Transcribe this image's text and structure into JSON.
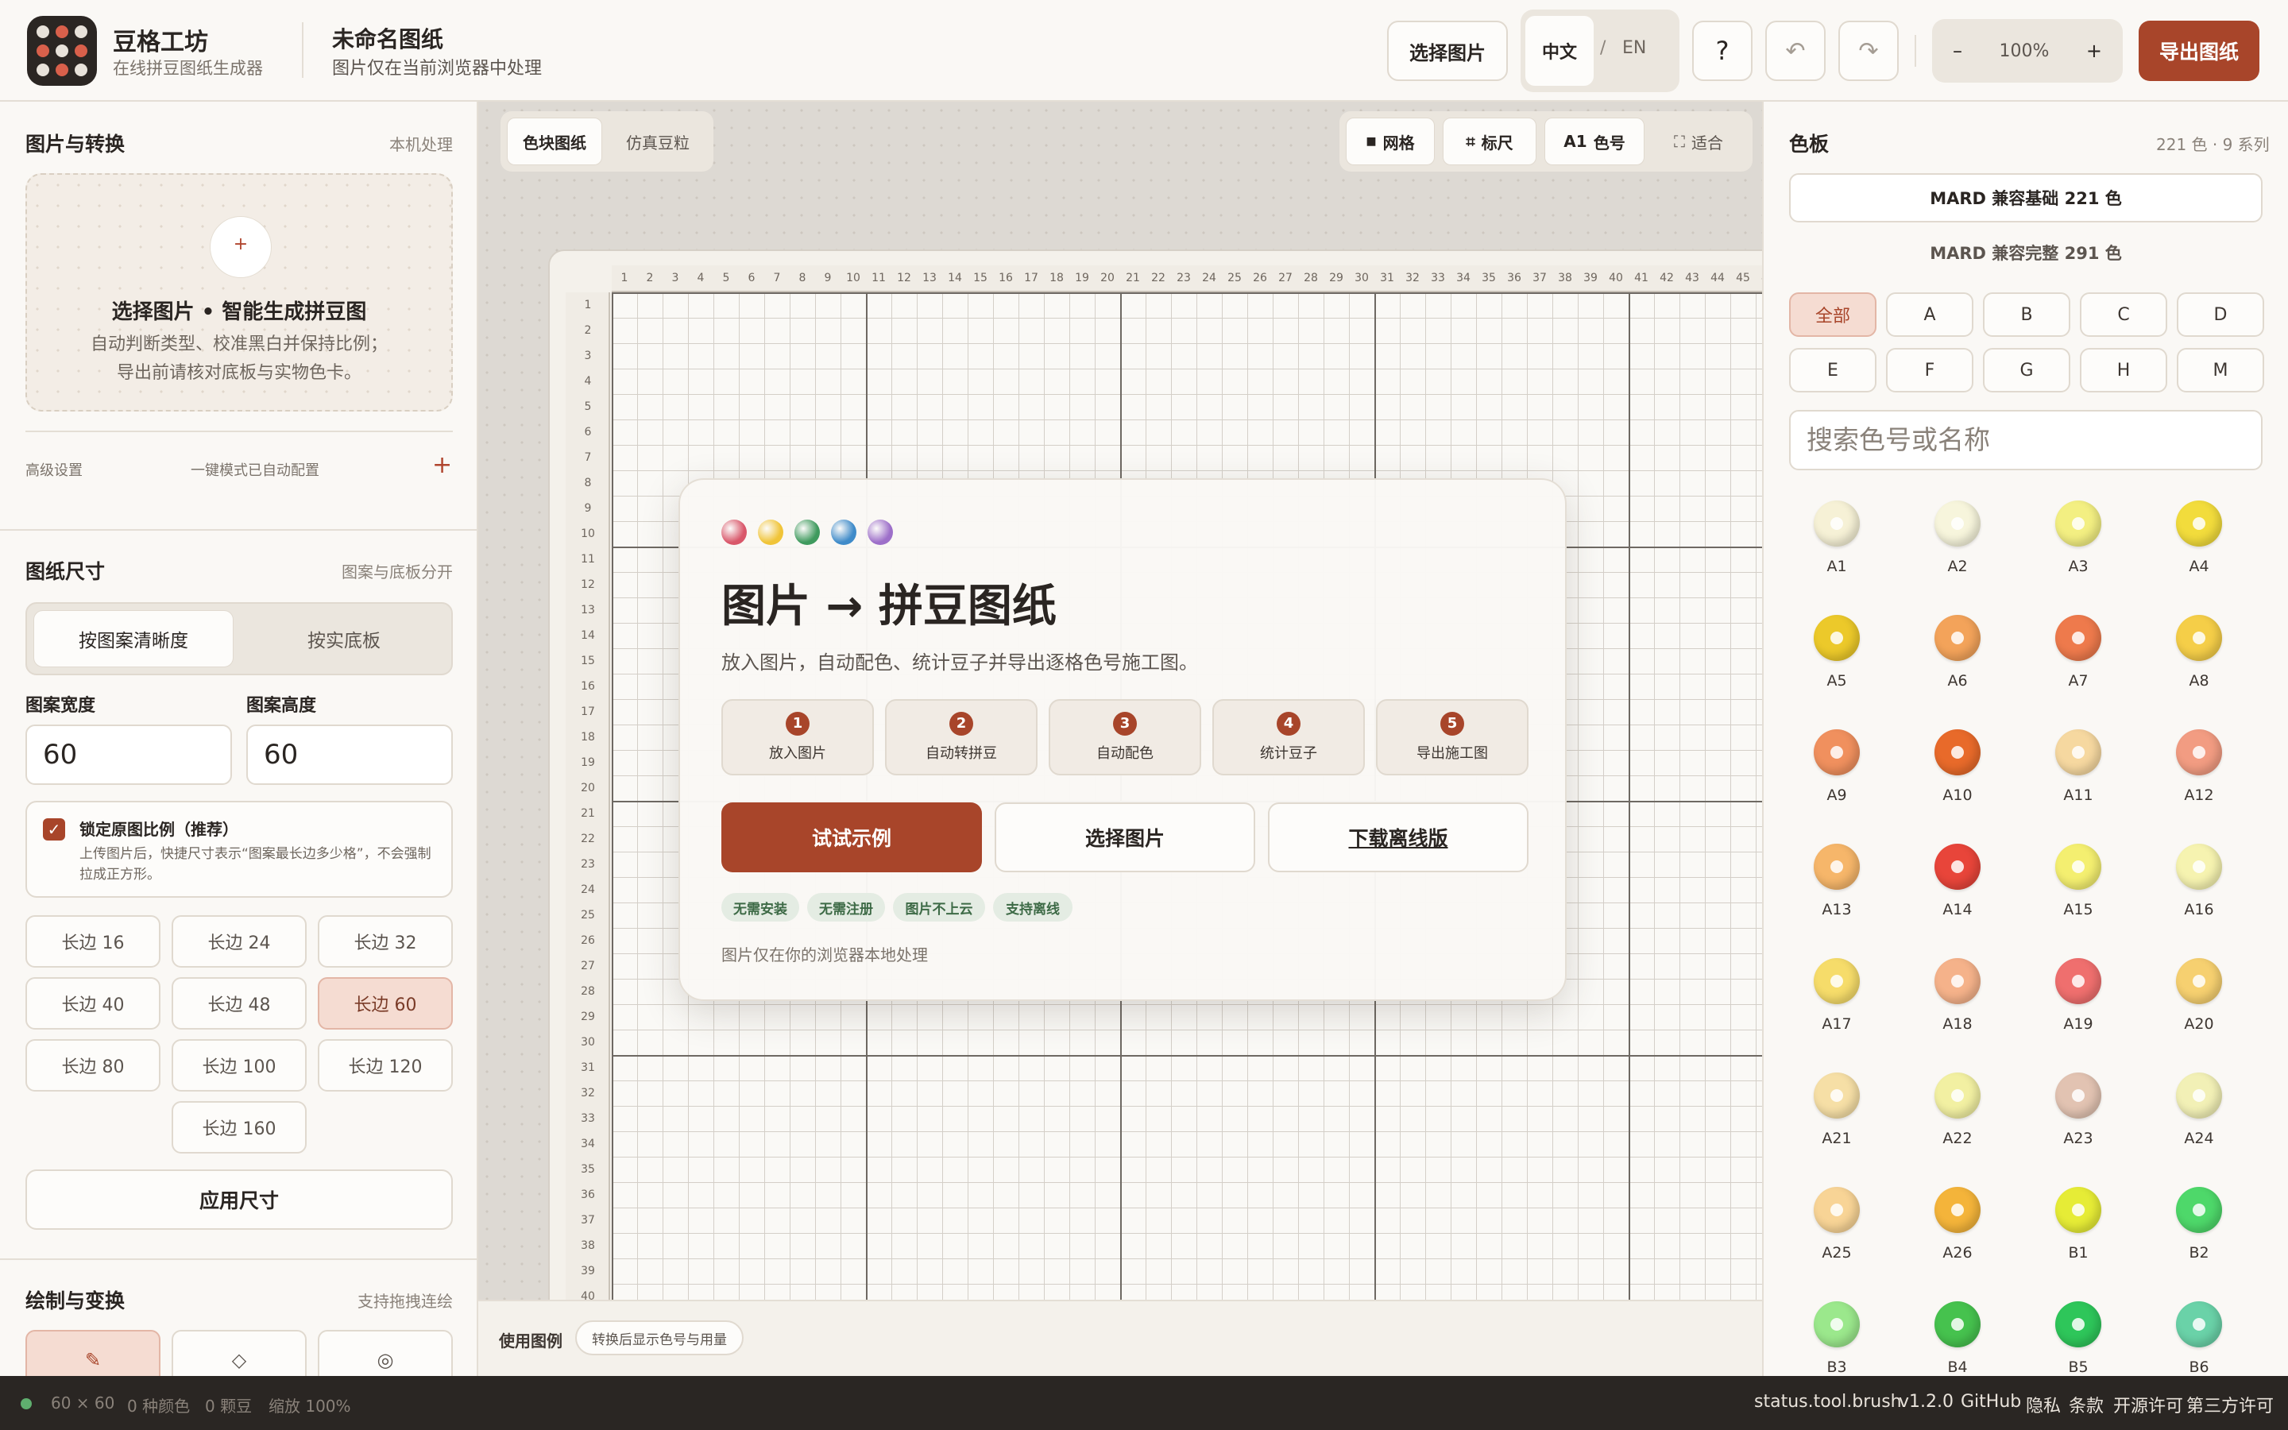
{
  "header": {
    "app_name": "豆格工坊",
    "app_sub": "在线拼豆图纸生成器",
    "doc_title": "未命名图纸",
    "doc_sub": "图片仅在当前浏览器中处理",
    "choose_image": "选择图片",
    "lang_zh": "中文",
    "lang_sep": "/",
    "lang_en": "EN",
    "help": "?",
    "undo": "↶",
    "redo": "↷",
    "zoom_minus": "–",
    "zoom_level": "100%",
    "zoom_plus": "+",
    "export": "导出图纸"
  },
  "left": {
    "image_section": {
      "title": "图片与转换",
      "note": "本机处理",
      "drop_plus": "+",
      "drop_title": "选择图片 • 智能生成拼豆图",
      "drop_desc1": "自动判断类型、校准黑白并保持比例；",
      "drop_desc2": "导出前请核对底板与实物色卡。",
      "advanced": "高级设置",
      "advanced_note": "一键模式已自动配置",
      "advanced_plus": "+"
    },
    "size_section": {
      "title": "图纸尺寸",
      "note": "图案与底板分开",
      "mode_on": "按图案清晰度",
      "mode_off": "按实底板",
      "width_label": "图案宽度",
      "height_label": "图案高度",
      "width_value": "60",
      "height_value": "60",
      "lock_checked": "✓",
      "lock_title": "锁定原图比例（推荐）",
      "lock_desc": "上传图片后，快捷尺寸表示“图案最长边多少格”，不会强制拉成正方形。",
      "presets": [
        "长边 16",
        "长边 24",
        "长边 32",
        "长边 40",
        "长边 48",
        "长边 60",
        "长边 80",
        "长边 100",
        "长边 120",
        "长边 160"
      ],
      "selected_preset": "长边 60",
      "apply": "应用尺寸"
    },
    "draw_section": {
      "title": "绘制与变换",
      "note": "支持拖拽连绘",
      "tools": [
        "✎",
        "◇",
        "◎"
      ]
    }
  },
  "center": {
    "tab_blocks": "色块图纸",
    "tab_beads": "仿真豆粒",
    "tool_grid_icon": "■",
    "tool_grid": "网格",
    "tool_ruler_icon": "⌗",
    "tool_ruler": "标尺",
    "tool_code_icon": "A1",
    "tool_code": "色号",
    "tool_fit_icon": "⛶",
    "tool_fit": "适合",
    "welcome": {
      "title": "图片 → 拼豆图纸",
      "subtitle": "放入图片，自动配色、统计豆子并导出逐格色号施工图。",
      "steps": [
        {
          "n": "1",
          "label": "放入图片"
        },
        {
          "n": "2",
          "label": "自动转拼豆"
        },
        {
          "n": "3",
          "label": "自动配色"
        },
        {
          "n": "4",
          "label": "统计豆子"
        },
        {
          "n": "5",
          "label": "导出施工图"
        }
      ],
      "try_example": "试试示例",
      "choose_image": "选择图片",
      "download_offline": "下载离线版",
      "tags": [
        "无需安装",
        "无需注册",
        "图片不上云",
        "支持离线"
      ],
      "note": "图片仅在你的浏览器本地处理",
      "dot_colors": [
        "#d9576a",
        "#f0c438",
        "#3f9a5e",
        "#3f8bc9",
        "#9d6fc9"
      ]
    },
    "legend_label": "使用图例",
    "legend_chip": "转换后显示色号与用量"
  },
  "right": {
    "title": "色板",
    "note": "221 色 · 9 系列",
    "palette_selected": "MARD 兼容基础 221 色",
    "palette_alt": "MARD 兼容完整 291 色",
    "filters": [
      "全部",
      "A",
      "B",
      "C",
      "D",
      "E",
      "F",
      "G",
      "H",
      "M"
    ],
    "search_placeholder": "搜索色号或名称",
    "swatches": [
      {
        "code": "A1",
        "color": "#f6f1d6"
      },
      {
        "code": "A2",
        "color": "#f7f5dc"
      },
      {
        "code": "A3",
        "color": "#f3ef82"
      },
      {
        "code": "A4",
        "color": "#f2dc3c"
      },
      {
        "code": "A5",
        "color": "#ecc92a"
      },
      {
        "code": "A6",
        "color": "#f3a35a"
      },
      {
        "code": "A7",
        "color": "#ee7a4c"
      },
      {
        "code": "A8",
        "color": "#f5ce48"
      },
      {
        "code": "A9",
        "color": "#f0905e"
      },
      {
        "code": "A10",
        "color": "#e86a2a"
      },
      {
        "code": "A11",
        "color": "#f6d8a0"
      },
      {
        "code": "A12",
        "color": "#f29c82"
      },
      {
        "code": "A13",
        "color": "#f6b66a"
      },
      {
        "code": "A14",
        "color": "#e8453a"
      },
      {
        "code": "A15",
        "color": "#f4ef70"
      },
      {
        "code": "A16",
        "color": "#f6f3b0"
      },
      {
        "code": "A17",
        "color": "#f6dc6a"
      },
      {
        "code": "A18",
        "color": "#f5b28a"
      },
      {
        "code": "A19",
        "color": "#ef6f6e"
      },
      {
        "code": "A20",
        "color": "#f6d070"
      },
      {
        "code": "A21",
        "color": "#f6dfa6"
      },
      {
        "code": "A22",
        "color": "#f2f0a2"
      },
      {
        "code": "A23",
        "color": "#e2c3b2"
      },
      {
        "code": "A24",
        "color": "#f2f0b6"
      },
      {
        "code": "A25",
        "color": "#f8d496"
      },
      {
        "code": "A26",
        "color": "#f4b43a"
      },
      {
        "code": "B1",
        "color": "#e6ec36"
      },
      {
        "code": "B2",
        "color": "#4ed86a"
      },
      {
        "code": "B3",
        "color": "#9be88c"
      },
      {
        "code": "B4",
        "color": "#46c24e"
      },
      {
        "code": "B5",
        "color": "#2ec65a"
      },
      {
        "code": "B6",
        "color": "#6ad2a8"
      }
    ]
  },
  "footer": {
    "size": "60 × 60",
    "colors": "0 种颜色",
    "beads": "0 颗豆",
    "zoom": "缩放 100%",
    "status": "status.tool.brush",
    "version": "v1.2.0",
    "github": "GitHub",
    "privacy": "隐私",
    "terms": "条款",
    "license": "开源许可",
    "third_party": "第三方许可"
  }
}
